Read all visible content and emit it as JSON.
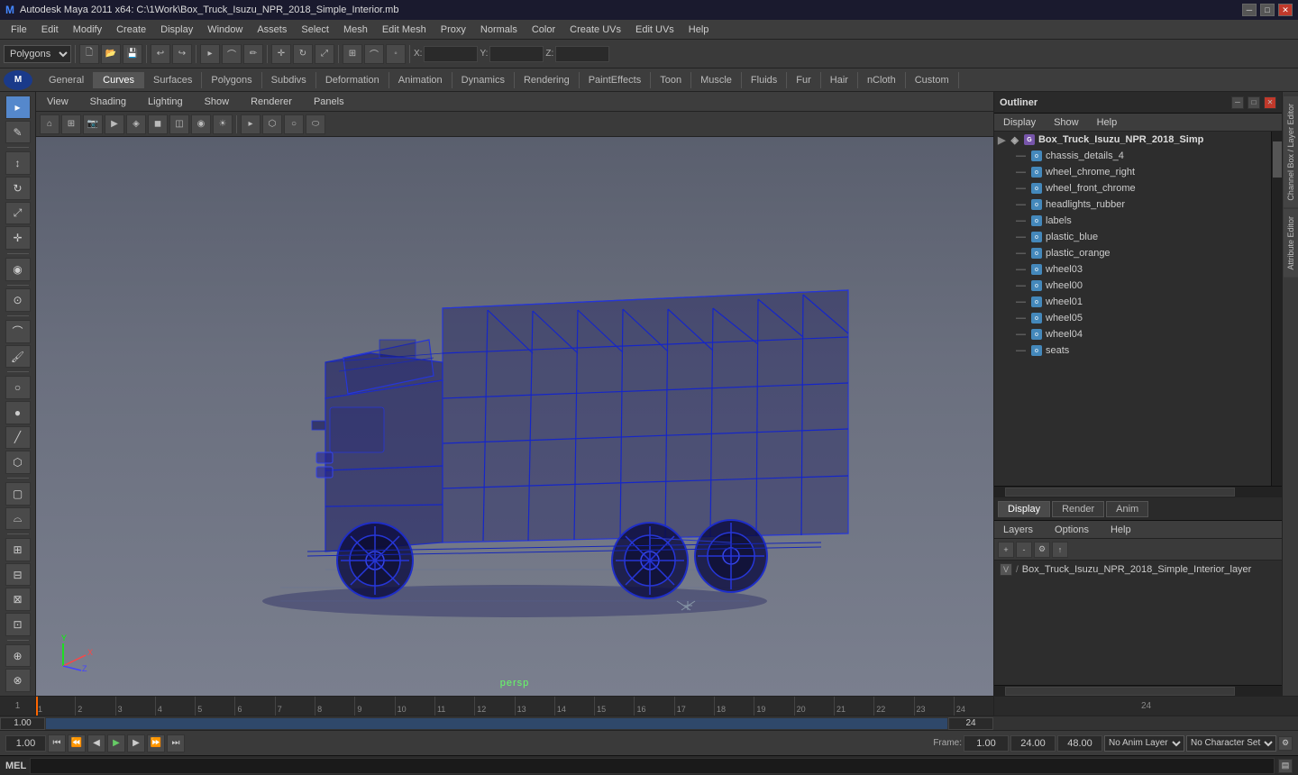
{
  "titlebar": {
    "title": "Autodesk Maya 2011 x64: C:\\1Work\\Box_Truck_Isuzu_NPR_2018_Simple_Interior.mb",
    "app_icon": "M"
  },
  "menubar": {
    "items": [
      "File",
      "Edit",
      "Modify",
      "Create",
      "Display",
      "Window",
      "Assets",
      "Select",
      "Mesh",
      "Edit Mesh",
      "Proxy",
      "Normals",
      "Color",
      "Create UVs",
      "Edit UVs",
      "Help"
    ]
  },
  "toolbar": {
    "mode_select": "Polygons"
  },
  "module_tabs": {
    "items": [
      "General",
      "Curves",
      "Surfaces",
      "Polygons",
      "Subdivs",
      "Deformation",
      "Animation",
      "Dynamics",
      "Rendering",
      "PaintEffects",
      "Toon",
      "Muscle",
      "Fluids",
      "Fur",
      "Hair",
      "nCloth",
      "Custom"
    ]
  },
  "viewport": {
    "view_menu": "View",
    "shading_menu": "Shading",
    "lighting_menu": "Lighting",
    "show_menu": "Show",
    "renderer_menu": "Renderer",
    "panels_menu": "Panels",
    "overlay_text": "persp",
    "scene_name": "Box_Truck_Isuzu_NPR_2018_Simple_Interior"
  },
  "outliner": {
    "title": "Outliner",
    "menus": [
      "Display",
      "Show",
      "Help"
    ],
    "items": [
      {
        "name": "Box_Truck_Isuzu_NPR_2018_Simp",
        "type": "group",
        "indent": 0
      },
      {
        "name": "chassis_details_4",
        "type": "mesh",
        "indent": 1
      },
      {
        "name": "wheel_chrome_right",
        "type": "mesh",
        "indent": 1
      },
      {
        "name": "wheel_front_chrome",
        "type": "mesh",
        "indent": 1
      },
      {
        "name": "headlights_rubber",
        "type": "mesh",
        "indent": 1
      },
      {
        "name": "labels",
        "type": "mesh",
        "indent": 1
      },
      {
        "name": "plastic_blue",
        "type": "mesh",
        "indent": 1
      },
      {
        "name": "plastic_orange",
        "type": "mesh",
        "indent": 1
      },
      {
        "name": "wheel03",
        "type": "mesh",
        "indent": 1
      },
      {
        "name": "wheel00",
        "type": "mesh",
        "indent": 1
      },
      {
        "name": "wheel01",
        "type": "mesh",
        "indent": 1
      },
      {
        "name": "wheel05",
        "type": "mesh",
        "indent": 1
      },
      {
        "name": "wheel04",
        "type": "mesh",
        "indent": 1
      },
      {
        "name": "seats",
        "type": "mesh",
        "indent": 1
      }
    ]
  },
  "layer_editor": {
    "tabs": [
      "Display",
      "Render",
      "Anim"
    ],
    "active_tab": "Display",
    "menus": [
      "Layers",
      "Options",
      "Help"
    ],
    "layers": [
      {
        "v": "V",
        "name": "Box_Truck_Isuzu_NPR_2018_Simple_Interior_layer"
      }
    ]
  },
  "timeline": {
    "start": "1",
    "end": "24",
    "ticks": [
      "1",
      "2",
      "3",
      "4",
      "5",
      "6",
      "7",
      "8",
      "9",
      "10",
      "11",
      "12",
      "13",
      "14",
      "15",
      "16",
      "17",
      "18",
      "19",
      "20",
      "21",
      "22",
      "23",
      "24"
    ],
    "current_frame": "1.00"
  },
  "bottom_controls": {
    "frame_start": "1.00",
    "frame_end": "24.00",
    "range_end": "48.00",
    "current": "1",
    "anim_layer": "No Anim Layer",
    "character_set": "No Character Set"
  },
  "mel_bar": {
    "label": "MEL",
    "placeholder": ""
  },
  "side_tabs": [
    "Channel Box / Layer Editor",
    "Attribute Editor"
  ],
  "vertical_tabs": [
    "Channel Box / Layer Editor",
    "Attribute Editor"
  ]
}
